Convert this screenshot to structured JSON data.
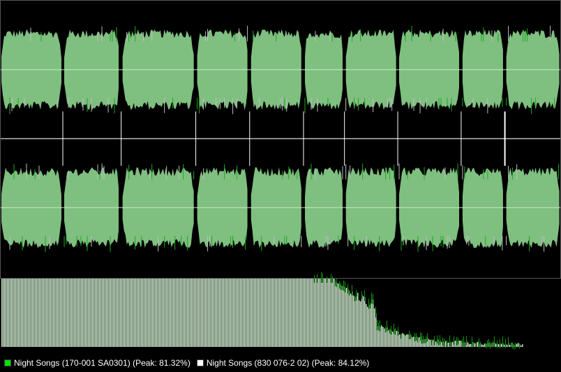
{
  "legend": [
    {
      "label": "Night Songs (170-001 SA0301) (Peak: 81.32%)",
      "color": "#00e000"
    },
    {
      "label": "Night Songs (830 076-2 02) (Peak: 84.12%)",
      "color": "#ffffff"
    }
  ],
  "colors": {
    "waveform_fill": "#7fbf80",
    "waveform_peak_a": "#1faa1f",
    "waveform_peak_b": "#bfbfbf",
    "center_line": "#cfe7cf",
    "spectrum_fill": "#d8f5d8",
    "spectrum_peak": "#0a9a0a",
    "track_marker": "#ffffff"
  },
  "track_markers": [
    0.112,
    0.216,
    0.349,
    0.445,
    0.541,
    0.614,
    0.709,
    0.822,
    0.9
  ]
}
